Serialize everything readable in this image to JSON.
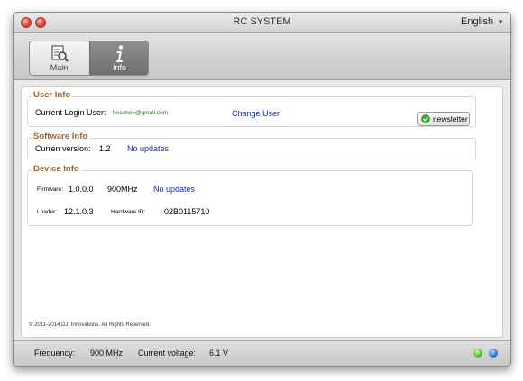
{
  "window": {
    "title": "RC SYSTEM",
    "language": "English"
  },
  "tabs": [
    {
      "label": "Main",
      "icon": "document-magnifier-icon",
      "active": false
    },
    {
      "label": "Info",
      "icon": "info-icon",
      "active": true
    }
  ],
  "user_info": {
    "legend": "User Info",
    "login_label": "Current Login User:",
    "email": "heechee@gmail.com",
    "change_user": "Change User",
    "newsletter": "newsletter"
  },
  "software_info": {
    "legend": "Software Info",
    "version_label": "Curren version:",
    "version": "1.2",
    "update_status": "No updates"
  },
  "device_info": {
    "legend": "Device Info",
    "firmware_label": "Firmware:",
    "firmware": "1.0.0.0",
    "frequency": "900MHz",
    "update_status": "No updates",
    "loader_label": "Loader:",
    "loader": "12.1.0.3",
    "hardware_label": "Hardware ID:",
    "hardware_id": "02B0115710"
  },
  "copyright": "© 2011-2014 DJI Innovations. All Rights Reserved.",
  "status": {
    "frequency_label": "Frequency:",
    "frequency": "900 MHz",
    "voltage_label": "Current voltage:",
    "voltage": "6.1 V"
  },
  "colors": {
    "legend": "#a8612a",
    "link": "#1b2a9a",
    "email": "#1f6b1f"
  }
}
